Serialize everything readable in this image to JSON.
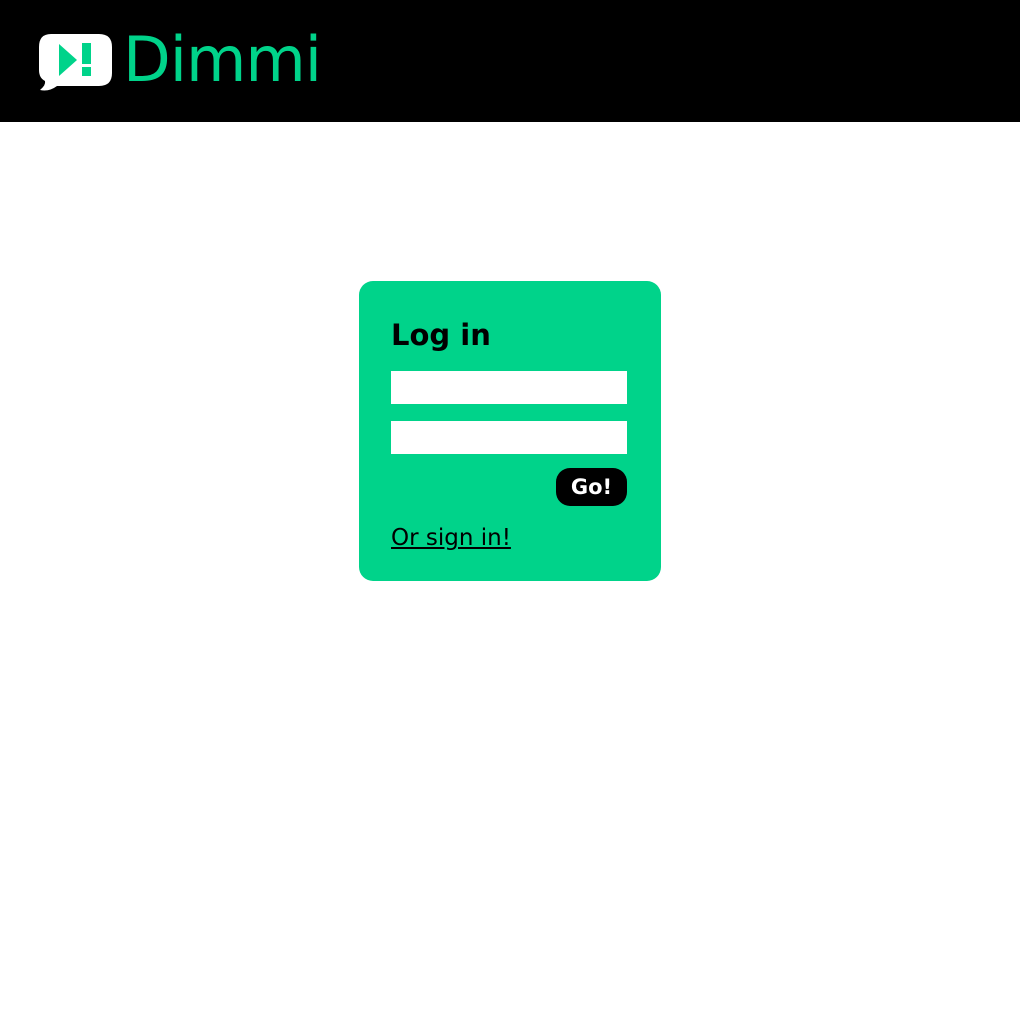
{
  "header": {
    "logo": {
      "text": "Dimmi",
      "icon": "speech-bubble-play-exclamation-icon"
    }
  },
  "login": {
    "title": "Log in",
    "username": {
      "value": "",
      "placeholder": ""
    },
    "password": {
      "value": "",
      "placeholder": ""
    },
    "submit_label": "Go!",
    "signin_link_label": "Or sign in!"
  },
  "colors": {
    "header_bg": "#000000",
    "brand_green": "#00d38a",
    "page_bg": "#ffffff",
    "button_bg": "#000000",
    "button_text": "#ffffff"
  }
}
